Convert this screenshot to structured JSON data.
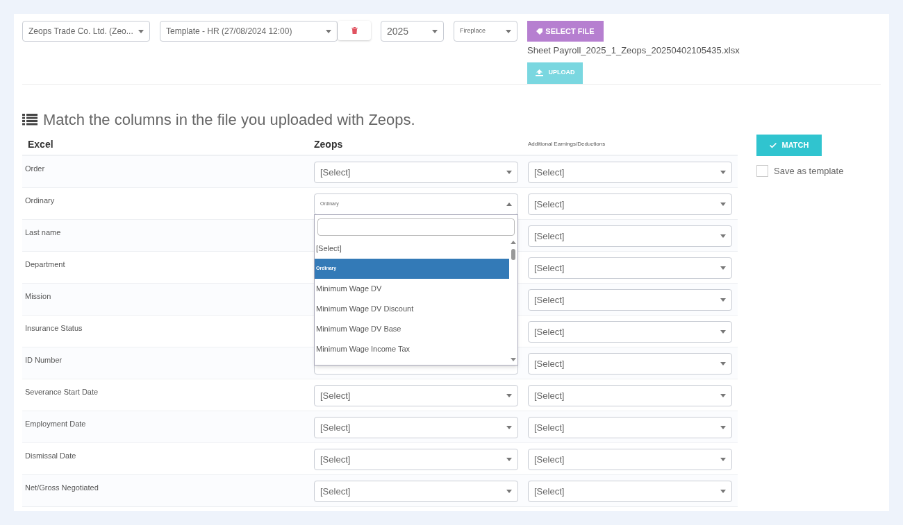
{
  "toolbar": {
    "company": "Zeops Trade Co. Ltd. (Zeo...",
    "template": "Template - HR (27/08/2024 12:00)",
    "year": "2025",
    "location": "Fireplace",
    "select_file": "SELECT FILE",
    "file_name": "Sheet Payroll_2025_1_Zeops_20250402105435.xlsx",
    "upload": "UPLOAD"
  },
  "heading": "Match the columns in the file you uploaded with Zeops.",
  "table": {
    "columns": [
      "Excel",
      "Zeops",
      "Additional Earnings/Deductions"
    ],
    "rows": [
      {
        "excel": "Order",
        "zeops": "[Select]",
        "additional": "[Select]"
      },
      {
        "excel": "Ordinary",
        "zeops": "Ordinary",
        "zeops_open": true,
        "additional": "[Select]"
      },
      {
        "excel": "Last name",
        "additional": "[Select]"
      },
      {
        "excel": "Department",
        "additional": "[Select]"
      },
      {
        "excel": "Mission",
        "additional": "[Select]"
      },
      {
        "excel": "Insurance Status",
        "additional": "[Select]"
      },
      {
        "excel": "ID Number",
        "additional": "[Select]"
      },
      {
        "excel": "Severance Start Date",
        "zeops": "[Select]",
        "additional": "[Select]"
      },
      {
        "excel": "Employment Date",
        "zeops": "[Select]",
        "additional": "[Select]"
      },
      {
        "excel": "Dismissal Date",
        "zeops": "[Select]",
        "additional": "[Select]"
      },
      {
        "excel": "Net/Gross Negotiated",
        "zeops": "[Select]",
        "additional": "[Select]"
      }
    ]
  },
  "dropdown": {
    "options": [
      {
        "label": "[Select]",
        "selected": false
      },
      {
        "label": "Ordinary",
        "selected": true
      },
      {
        "label": "Minimum Wage DV",
        "selected": false
      },
      {
        "label": "Minimum Wage DV Discount",
        "selected": false
      },
      {
        "label": "Minimum Wage DV Base",
        "selected": false
      },
      {
        "label": "Minimum Wage Income Tax",
        "selected": false
      }
    ]
  },
  "match_button": "MATCH",
  "save_template": {
    "label": "Save as template",
    "checked": false
  }
}
